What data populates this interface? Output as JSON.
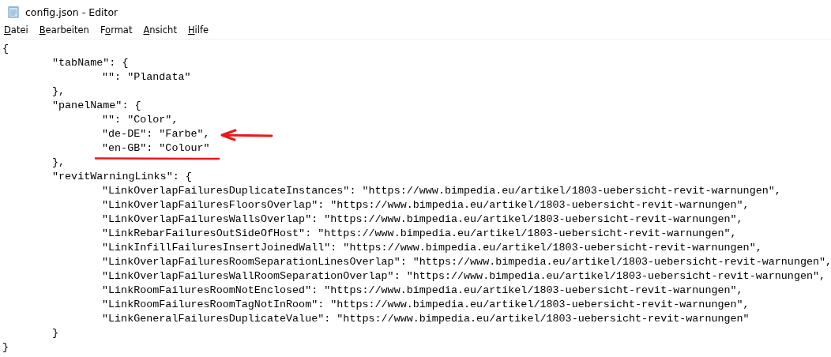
{
  "window": {
    "title": "config.json - Editor"
  },
  "menu": [
    {
      "key": "D",
      "after": "atei"
    },
    {
      "key": "B",
      "after": "earbeiten"
    },
    {
      "before": "F",
      "key": "o",
      "after": "rmat"
    },
    {
      "key": "A",
      "after": "nsicht"
    },
    {
      "key": "H",
      "after": "ilfe"
    }
  ],
  "lines": [
    {
      "text": "{"
    },
    {
      "text": "\t\"tabName\": {"
    },
    {
      "text": "\t\t\"\": \"Plandata\""
    },
    {
      "text": "\t},"
    },
    {
      "text": "\t\"panelName\": {"
    },
    {
      "text": "\t\t\"\": \"Color\","
    },
    {
      "text": "\t\t\"de-DE\": \"Farbe\",",
      "arrow": true
    },
    {
      "text": "\t\t\"en-GB\": \"Colour\"",
      "underlined": true
    },
    {
      "text": "\t},"
    },
    {
      "text": "\t\"revitWarningLinks\": {"
    },
    {
      "text": "\t\t\"LinkOverlapFailuresDuplicateInstances\": \"https://www.bimpedia.eu/artikel/1803-uebersicht-revit-warnungen\","
    },
    {
      "text": "\t\t\"LinkOverlapFailuresFloorsOverlap\": \"https://www.bimpedia.eu/artikel/1803-uebersicht-revit-warnungen\","
    },
    {
      "text": "\t\t\"LinkOverlapFailuresWallsOverlap\": \"https://www.bimpedia.eu/artikel/1803-uebersicht-revit-warnungen\","
    },
    {
      "text": "\t\t\"LinkRebarFailuresOutSideOfHost\": \"https://www.bimpedia.eu/artikel/1803-uebersicht-revit-warnungen\","
    },
    {
      "text": "\t\t\"LinkInfillFailuresInsertJoinedWall\": \"https://www.bimpedia.eu/artikel/1803-uebersicht-revit-warnungen\","
    },
    {
      "text": "\t\t\"LinkOverlapFailuresRoomSeparationLinesOverlap\": \"https://www.bimpedia.eu/artikel/1803-uebersicht-revit-warnungen\","
    },
    {
      "text": "\t\t\"LinkOverlapFailuresWallRoomSeparationOverlap\": \"https://www.bimpedia.eu/artikel/1803-uebersicht-revit-warnungen\","
    },
    {
      "text": "\t\t\"LinkRoomFailuresRoomNotEnclosed\": \"https://www.bimpedia.eu/artikel/1803-uebersicht-revit-warnungen\","
    },
    {
      "text": "\t\t\"LinkRoomFailuresRoomTagNotInRoom\": \"https://www.bimpedia.eu/artikel/1803-uebersicht-revit-warnungen\","
    },
    {
      "text": "\t\t\"LinkGeneralFailuresDuplicateValue\": \"https://www.bimpedia.eu/artikel/1803-uebersicht-revit-warnungen\""
    },
    {
      "text": "\t}"
    },
    {
      "text": "}"
    }
  ]
}
